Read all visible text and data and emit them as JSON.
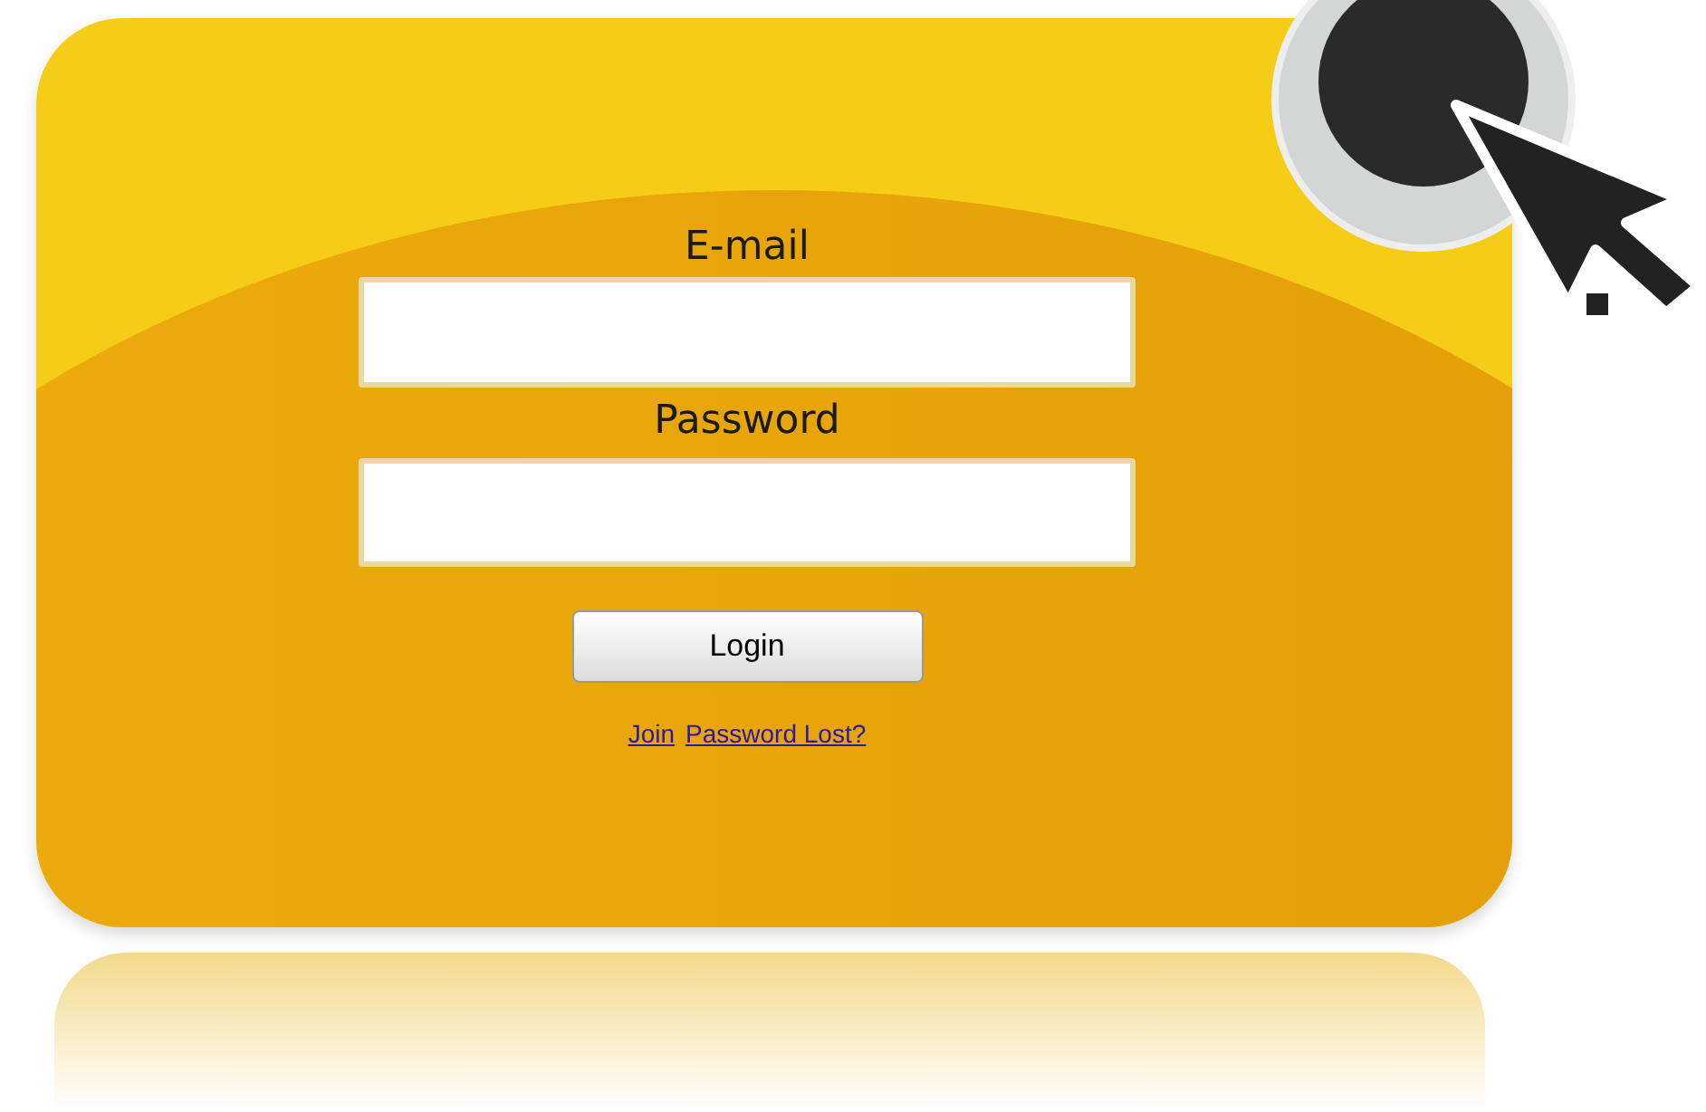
{
  "login_form": {
    "email_label": "E-mail",
    "password_label": "Password",
    "login_button": "Login",
    "links": [
      "Join",
      "Password Lost?"
    ]
  }
}
